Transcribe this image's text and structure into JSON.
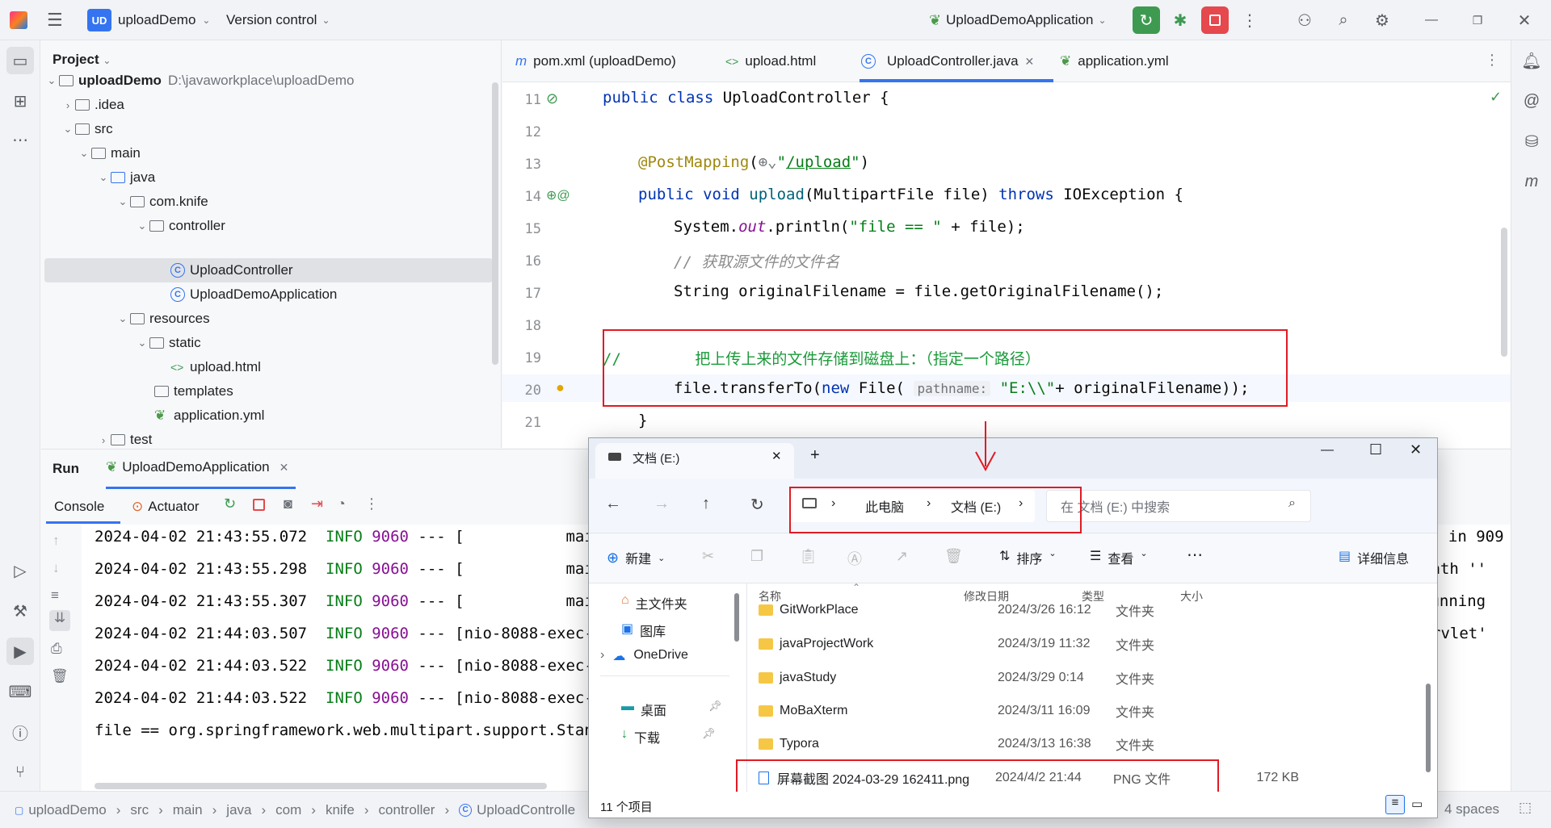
{
  "titlebar": {
    "project_badge": "UD",
    "project_name": "uploadDemo",
    "vcs_label": "Version control",
    "run_config": "UploadDemoApplication"
  },
  "project_panel": {
    "title": "Project",
    "root_name": "uploadDemo",
    "root_path": "D:\\javaworkplace\\uploadDemo",
    "items": [
      {
        "label": "uploadDemo"
      },
      {
        "label": ".idea"
      },
      {
        "label": "src"
      },
      {
        "label": "main"
      },
      {
        "label": "java"
      },
      {
        "label": "com.knife"
      },
      {
        "label": "controller"
      },
      {
        "label": "UploadController"
      },
      {
        "label": "UploadDemoApplication"
      },
      {
        "label": "resources"
      },
      {
        "label": "static"
      },
      {
        "label": "upload.html"
      },
      {
        "label": "templates"
      },
      {
        "label": "application.yml"
      },
      {
        "label": "test"
      }
    ]
  },
  "editor": {
    "tabs": [
      {
        "label": "pom.xml (uploadDemo)"
      },
      {
        "label": "upload.html"
      },
      {
        "label": "UploadController.java"
      },
      {
        "label": "application.yml"
      }
    ],
    "lines": [
      {
        "num": "11",
        "text": "public class UploadController {"
      },
      {
        "num": "12",
        "text": ""
      },
      {
        "num": "13",
        "text": "@PostMapping(\"/upload\")"
      },
      {
        "num": "14",
        "text": "public void upload(MultipartFile file) throws IOException {"
      },
      {
        "num": "15",
        "text": "System.out.println(\"file == \" + file);"
      },
      {
        "num": "16",
        "text": "// 获取源文件的文件名"
      },
      {
        "num": "17",
        "text": "String originalFilename = file.getOriginalFilename();"
      },
      {
        "num": "18",
        "text": ""
      },
      {
        "num": "19",
        "text": "//        把上传上来的文件存储到磁盘上：（指定一个路径）"
      },
      {
        "num": "20",
        "text": "file.transferTo(new File( pathname: \"E:\\\\\"+ originalFilename));"
      },
      {
        "num": "21",
        "text": "}"
      }
    ]
  },
  "run_panel": {
    "run_label": "Run",
    "app_tab": "UploadDemoApplication",
    "console_tab": "Console",
    "actuator_tab": "Actuator",
    "logs": [
      {
        "ts": "2024-04-02 21:43:55.072",
        "level": "INFO",
        "pid": "9060",
        "rest": " --- [           main]",
        "tail": "d in 909"
      },
      {
        "ts": "2024-04-02 21:43:55.298",
        "level": "INFO",
        "pid": "9060",
        "rest": " --- [           main]",
        "tail": "path ''"
      },
      {
        "ts": "2024-04-02 21:43:55.307",
        "level": "INFO",
        "pid": "9060",
        "rest": " --- [           main]",
        "tail": "running"
      },
      {
        "ts": "2024-04-02 21:44:03.507",
        "level": "INFO",
        "pid": "9060",
        "rest": " --- [nio-8088-exec-2]",
        "tail": "rvlet'"
      },
      {
        "ts": "2024-04-02 21:44:03.522",
        "level": "INFO",
        "pid": "9060",
        "rest": " --- [nio-8088-exec-2]",
        "tail": ""
      },
      {
        "ts": "2024-04-02 21:44:03.522",
        "level": "INFO",
        "pid": "9060",
        "rest": " --- [nio-8088-exec-2]",
        "tail": ""
      }
    ],
    "last_line": "file == org.springframework.web.multipart.support.Standa"
  },
  "statusbar": {
    "crumbs": [
      "uploadDemo",
      "src",
      "main",
      "java",
      "com",
      "knife",
      "controller",
      "UploadControlle"
    ],
    "indent": "4 spaces"
  },
  "explorer": {
    "title": "文档 (E:)",
    "crumbs": [
      "此电脑",
      "文档 (E:)"
    ],
    "search_placeholder": "在 文档 (E:) 中搜索",
    "cmd": {
      "new": "新建",
      "sort": "排序",
      "view": "查看",
      "details": "详细信息"
    },
    "nav": [
      {
        "label": "主文件夹"
      },
      {
        "label": "图库"
      },
      {
        "label": "OneDrive"
      },
      {
        "label": "桌面"
      },
      {
        "label": "下载"
      }
    ],
    "columns": {
      "name": "名称",
      "date": "修改日期",
      "type": "类型",
      "size": "大小"
    },
    "files": [
      {
        "name": "GitWorkPlace",
        "date": "2024/3/26 16:12",
        "type": "文件夹",
        "size": ""
      },
      {
        "name": "javaProjectWork",
        "date": "2024/3/19 11:32",
        "type": "文件夹",
        "size": ""
      },
      {
        "name": "javaStudy",
        "date": "2024/3/29 0:14",
        "type": "文件夹",
        "size": ""
      },
      {
        "name": "MoBaXterm",
        "date": "2024/3/11 16:09",
        "type": "文件夹",
        "size": ""
      },
      {
        "name": "Typora",
        "date": "2024/3/13 16:38",
        "type": "文件夹",
        "size": ""
      },
      {
        "name": "屏幕截图 2024-03-29 162411.png",
        "date": "2024/4/2 21:44",
        "type": "PNG 文件",
        "size": "172 KB"
      }
    ],
    "item_count": "11 个项目"
  }
}
